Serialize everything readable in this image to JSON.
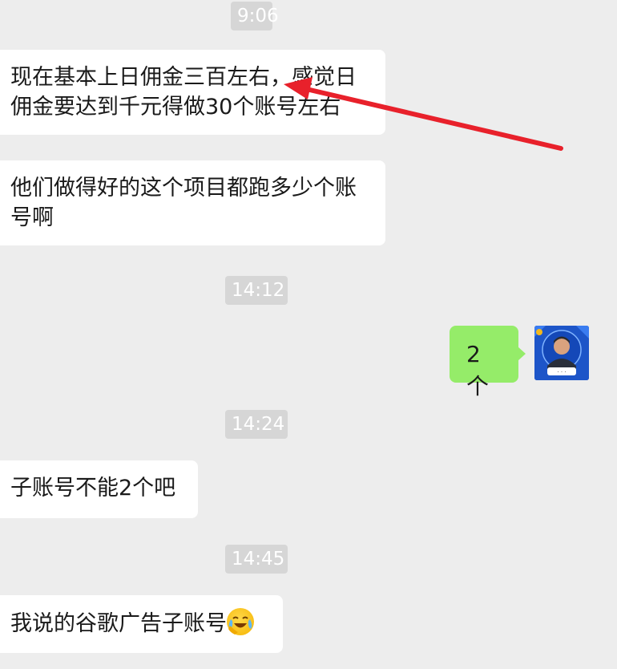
{
  "chat": {
    "timestamps": [
      "9:06",
      "14:12",
      "14:24",
      "14:45"
    ],
    "messages": [
      {
        "text": "现在基本上日佣金三百左右，感觉日佣金要达到千元得做30个账号左右"
      },
      {
        "text": "他们做得好的这个项目都跑多少个账号啊"
      },
      {
        "text": "2个"
      },
      {
        "text": "子账号不能2个吧"
      },
      {
        "text": "我说的谷歌广告子账号",
        "emoji": "crying-laughing-icon"
      }
    ]
  },
  "colors": {
    "background": "#ededed",
    "incoming_bubble": "#ffffff",
    "outgoing_bubble": "#95ec69",
    "timestamp_bg": "#d6d6d6",
    "annotation_arrow": "#e8212b"
  }
}
